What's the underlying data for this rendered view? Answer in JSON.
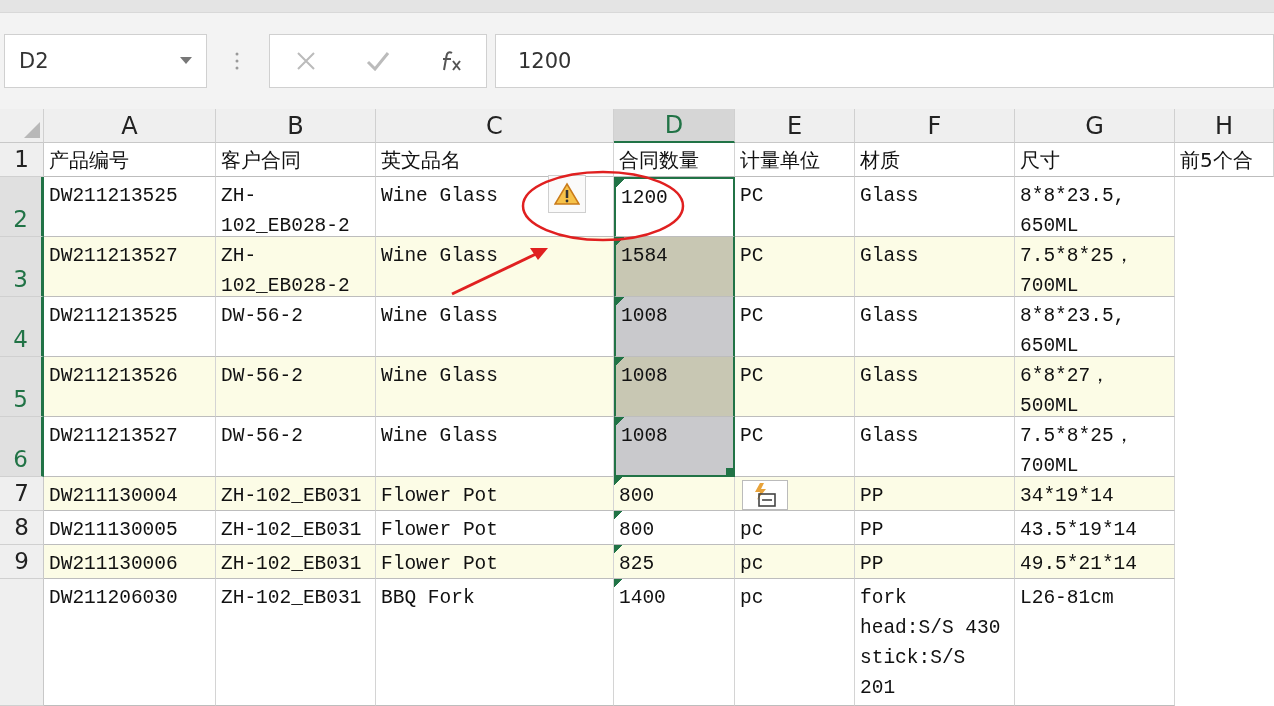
{
  "name_box": {
    "value": "D2"
  },
  "formula_bar": {
    "value": "1200"
  },
  "columns": [
    {
      "label": "A",
      "selected": false
    },
    {
      "label": "B",
      "selected": false
    },
    {
      "label": "C",
      "selected": false
    },
    {
      "label": "D",
      "selected": true
    },
    {
      "label": "E",
      "selected": false
    },
    {
      "label": "F",
      "selected": false
    },
    {
      "label": "G",
      "selected": false
    },
    {
      "label": "H",
      "selected": false
    }
  ],
  "rows": [
    {
      "number": "1",
      "selected": false,
      "band": false,
      "d_selected": false,
      "d_flag": false,
      "cells": [
        "产品编号",
        "客户合同",
        "英文品名",
        "合同数量",
        "计量单位",
        "材质",
        "尺寸",
        "前5个合"
      ]
    },
    {
      "number": "2",
      "selected": true,
      "band": false,
      "d_selected": true,
      "d_active": true,
      "d_flag": true,
      "cells": [
        "DW211213525",
        "ZH-\n102_EB028-2",
        "Wine Glass",
        "1200",
        "PC",
        "Glass",
        "8*8*23.5,\n650ML"
      ]
    },
    {
      "number": "3",
      "selected": true,
      "band": true,
      "d_selected": true,
      "d_active": false,
      "d_flag": true,
      "cells": [
        "DW211213527",
        "ZH-\n102_EB028-2",
        "Wine Glass",
        "1584",
        "PC",
        "Glass",
        "7.5*8*25，\n700ML"
      ]
    },
    {
      "number": "4",
      "selected": true,
      "band": false,
      "d_selected": true,
      "d_active": false,
      "d_flag": true,
      "cells": [
        "DW211213525",
        "DW-56-2",
        "Wine Glass",
        "1008",
        "PC",
        "Glass",
        "8*8*23.5,\n650ML"
      ]
    },
    {
      "number": "5",
      "selected": true,
      "band": true,
      "d_selected": true,
      "d_active": false,
      "d_flag": true,
      "cells": [
        "DW211213526",
        "DW-56-2",
        "Wine Glass",
        "1008",
        "PC",
        "Glass",
        "6*8*27，\n500ML"
      ]
    },
    {
      "number": "6",
      "selected": true,
      "band": false,
      "d_selected": true,
      "d_active": false,
      "d_flag": true,
      "cells": [
        "DW211213527",
        "DW-56-2",
        "Wine Glass",
        "1008",
        "PC",
        "Glass",
        "7.5*8*25，\n700ML"
      ]
    },
    {
      "number": "7",
      "selected": false,
      "band": true,
      "d_selected": false,
      "d_flag": true,
      "cells": [
        "DW211130004",
        "ZH-102_EB031",
        "Flower Pot",
        "800",
        null,
        "PP",
        "34*19*14"
      ]
    },
    {
      "number": "8",
      "selected": false,
      "band": false,
      "d_selected": false,
      "d_flag": true,
      "cells": [
        "DW211130005",
        "ZH-102_EB031",
        "Flower Pot",
        "800",
        "pc",
        "PP",
        "43.5*19*14"
      ]
    },
    {
      "number": "9",
      "selected": false,
      "band": true,
      "d_selected": false,
      "d_flag": true,
      "cells": [
        "DW211130006",
        "ZH-102_EB031",
        "Flower Pot",
        "825",
        "pc",
        "PP",
        "49.5*21*14"
      ]
    },
    {
      "selected": false,
      "band": false,
      "d_selected": false,
      "d_flag": true,
      "cells": [
        "DW211206030",
        "ZH-102_EB031",
        "BBQ Fork",
        "1400",
        "pc",
        "fork\nhead:S/S 430\nstick:S/S\n201",
        "L26-81cm"
      ]
    }
  ]
}
